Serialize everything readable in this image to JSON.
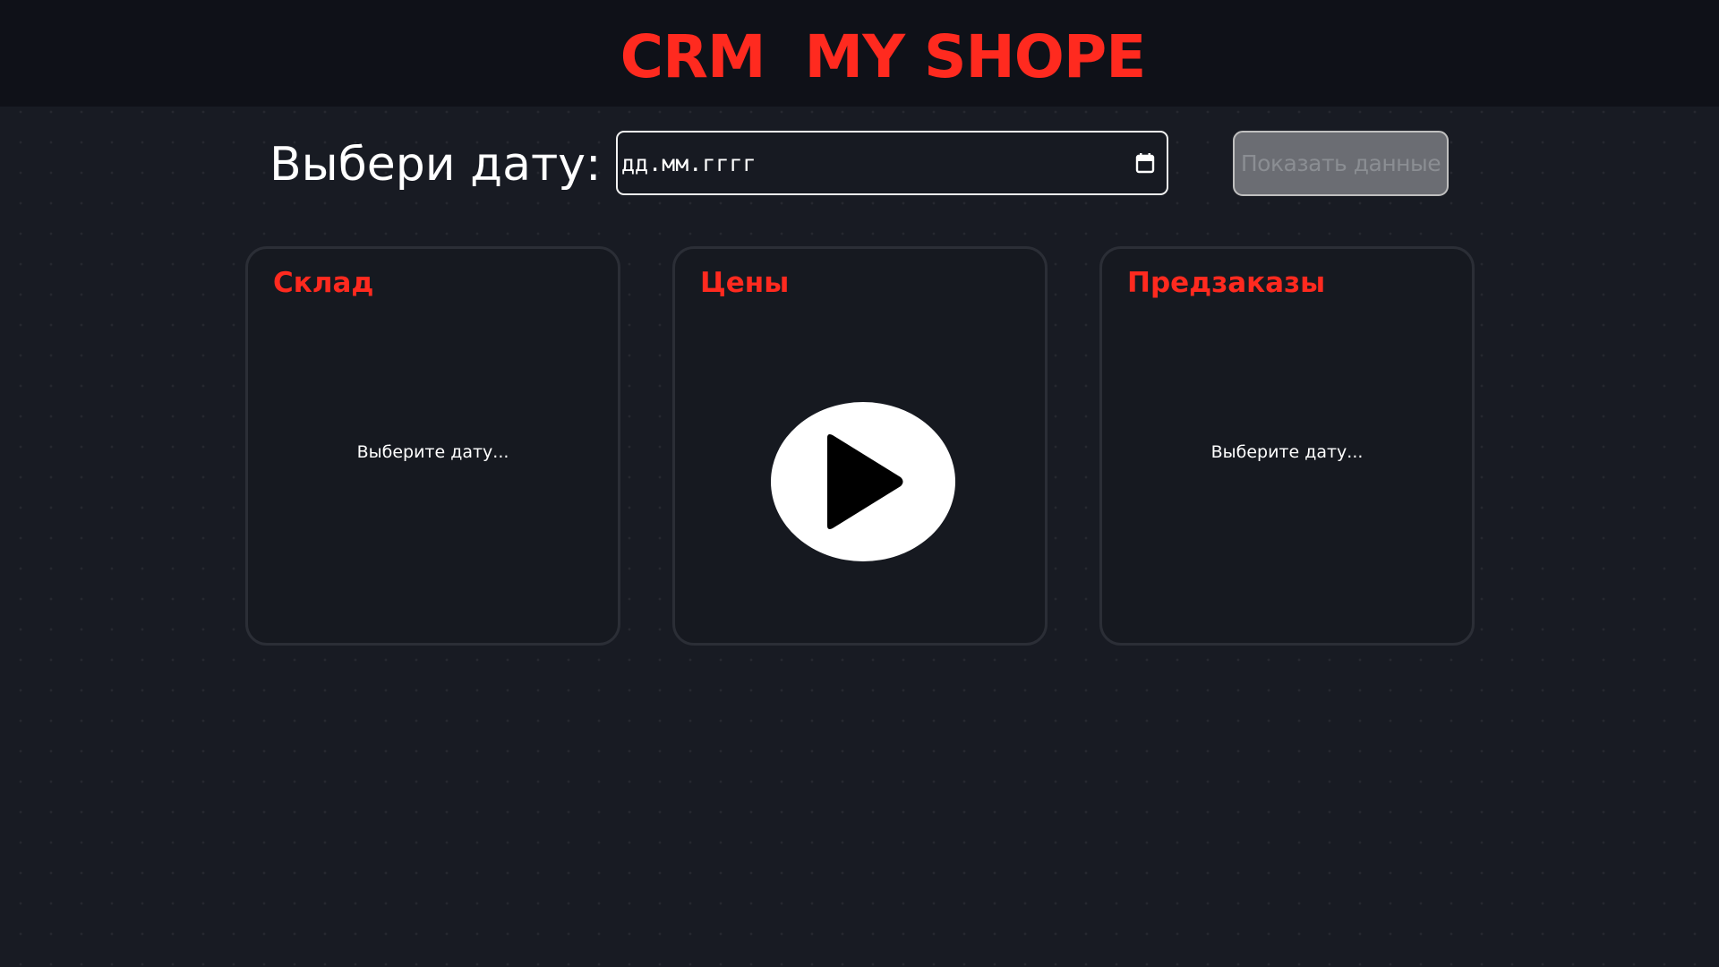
{
  "header": {
    "title": "CRM  MY SHOPE"
  },
  "date_picker": {
    "label": "Выбери дату:",
    "input_value": "дд.мм.гггг",
    "icon": "calendar-icon"
  },
  "show_button": {
    "label": "Показать данные"
  },
  "cards": [
    {
      "title": "Склад",
      "placeholder": "Выберите дату..."
    },
    {
      "title": "Цены",
      "icon": "play-icon"
    },
    {
      "title": "Предзаказы",
      "placeholder": "Выберите дату..."
    }
  ],
  "colors": {
    "accent": "#ff2a1f",
    "background": "#181b23",
    "header_background": "#0f1118",
    "card_border": "#2b2e36",
    "button_background": "#6b6d73"
  }
}
